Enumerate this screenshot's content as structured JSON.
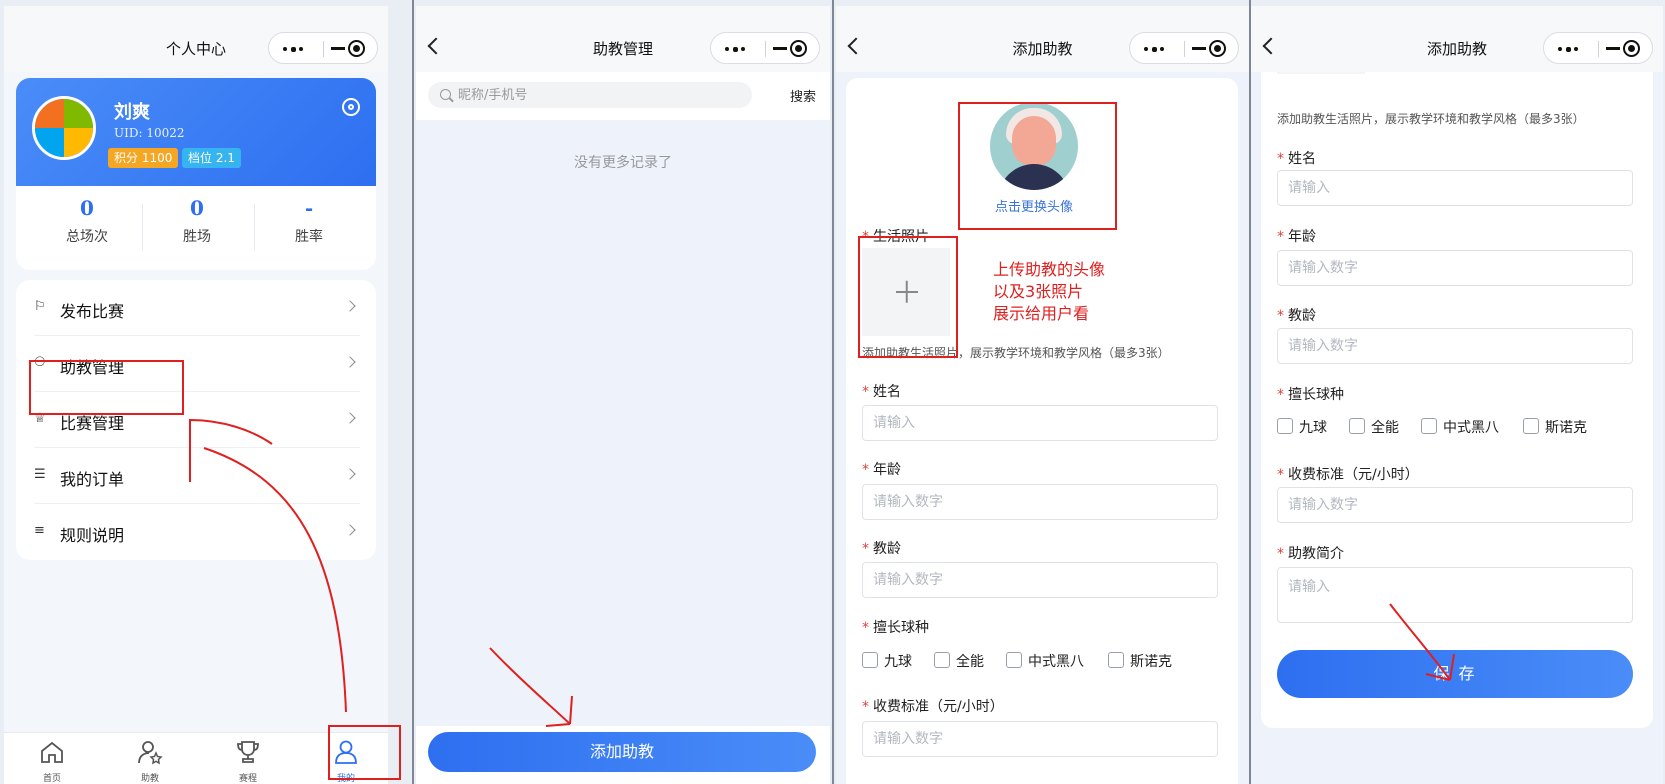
{
  "colors": {
    "brand": "#2d6ff0",
    "annotation": "#e0201f",
    "required": "#e0423b",
    "badge_points": "#f5a623",
    "badge_rank": "#35b4f0"
  },
  "screen_personal": {
    "nav_title": "个人中心",
    "user": {
      "name": "刘爽",
      "uid": "UID: 10022",
      "points": "积分 1100",
      "rank": "档位 2.1"
    },
    "stats": [
      {
        "value": "0",
        "label": "总场次"
      },
      {
        "value": "0",
        "label": "胜场"
      },
      {
        "value": "-",
        "label": "胜率"
      }
    ],
    "menu": [
      {
        "label": "发布比赛",
        "icon": "flag-icon"
      },
      {
        "label": "助教管理",
        "icon": "users-icon"
      },
      {
        "label": "比赛管理",
        "icon": "trophy-icon"
      },
      {
        "label": "我的订单",
        "icon": "list-icon"
      },
      {
        "label": "规则说明",
        "icon": "sliders-icon"
      }
    ],
    "tabs": [
      {
        "label": "首页"
      },
      {
        "label": "助教"
      },
      {
        "label": "赛程"
      },
      {
        "label": "我的"
      }
    ]
  },
  "screen_coach_mgmt": {
    "nav_title": "助教管理",
    "search_placeholder": "昵称/手机号",
    "search_button": "搜索",
    "empty_text": "没有更多记录了",
    "add_button": "添加助教"
  },
  "screen_add_coach": {
    "nav_title": "添加助教",
    "change_avatar": "点击更换头像",
    "photos_label": "生活照片",
    "photos_hint": "添加助教生活照片，展示教学环境和教学风格（最多3张）",
    "name_label": "姓名",
    "name_placeholder": "请输入",
    "age_label": "年龄",
    "age_placeholder": "请输入数字",
    "years_label": "教龄",
    "years_placeholder": "请输入数字",
    "ball_label": "擅长球种",
    "ball_options": [
      "九球",
      "全能",
      "中式黑八",
      "斯诺克"
    ],
    "fee_label": "收费标准（元/小时）",
    "fee_placeholder": "请输入数字",
    "intro_label": "助教简介",
    "intro_placeholder": "请输入",
    "save_button": "保 存"
  },
  "annotation_note": [
    "上传助教的头像",
    "以及3张照片",
    "展示给用户看"
  ]
}
